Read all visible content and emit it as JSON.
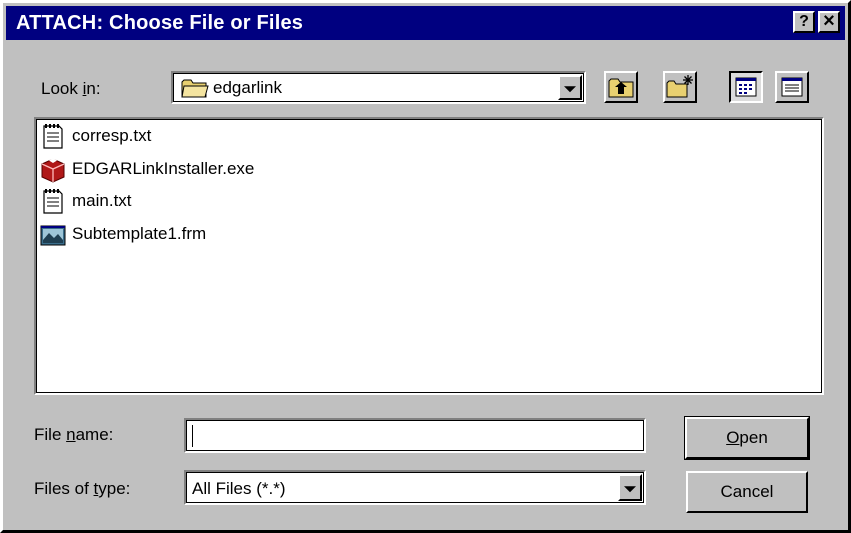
{
  "window": {
    "title": "ATTACH: Choose File or Files",
    "help_button": "?",
    "close_button": "×"
  },
  "look_in": {
    "label_pre": "Look ",
    "label_ul": "i",
    "label_post": "n:",
    "value": "edgarlink",
    "icon": "folder-icon"
  },
  "toolbar": {
    "buttons": [
      {
        "name": "up-one-level",
        "icon": "folder-up-icon"
      },
      {
        "name": "create-new-folder",
        "icon": "new-folder-icon"
      },
      {
        "name": "list-view",
        "icon": "list-view-icon",
        "pressed": true
      },
      {
        "name": "details-view",
        "icon": "details-view-icon",
        "pressed": false
      }
    ]
  },
  "files": [
    {
      "name": "corresp.txt",
      "icon": "text-file-icon"
    },
    {
      "name": "EDGARLinkInstaller.exe",
      "icon": "installer-package-icon"
    },
    {
      "name": "main.txt",
      "icon": "text-file-icon"
    },
    {
      "name": "Subtemplate1.frm",
      "icon": "form-file-icon"
    }
  ],
  "file_name": {
    "label_pre": "File ",
    "label_ul": "n",
    "label_post": "ame:",
    "value": "",
    "placeholder": ""
  },
  "file_type": {
    "label_pre": "Files of ",
    "label_ul": "t",
    "label_post": "ype:",
    "value": "All Files (*.*)"
  },
  "buttons": {
    "open_ul": "O",
    "open_rest": "pen",
    "cancel": "Cancel"
  },
  "colors": {
    "titlebar": "#000080",
    "face": "#c0c0c0"
  }
}
